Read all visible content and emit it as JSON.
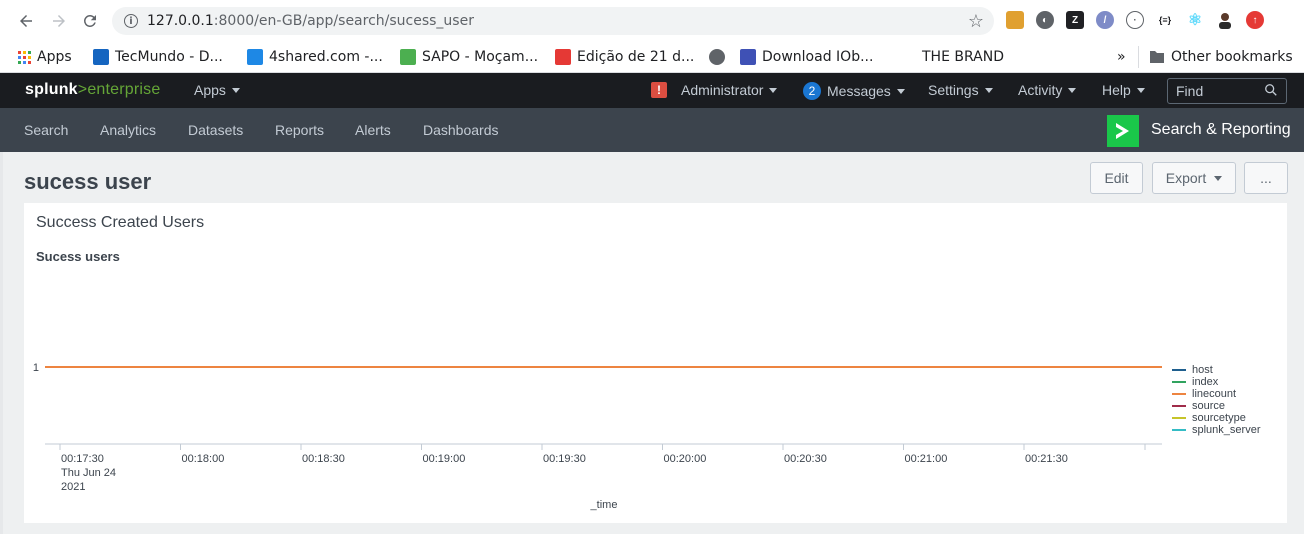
{
  "browser": {
    "url_host": "127.0.0.1",
    "url_path": ":8000/en-GB/app/search/sucess_user",
    "bookmarks": [
      {
        "label": "Apps",
        "color": "#4285f4"
      },
      {
        "label": "TecMundo - D...",
        "color": "#1565c0"
      },
      {
        "label": "4shared.com -...",
        "color": "#1e88e5"
      },
      {
        "label": "SAPO - Moçam...",
        "color": "#4caf50"
      },
      {
        "label": "Edição de 21 d...",
        "color": "#e53935"
      },
      {
        "label": "Download IOb...",
        "color": "#3f51b5"
      },
      {
        "label": "THE BRAND",
        "color": "#ffffff"
      }
    ],
    "more_label": "»",
    "other_bookmarks": "Other bookmarks"
  },
  "splunk": {
    "logo_splunk": "splunk",
    "logo_gt": ">",
    "logo_enterprise": "enterprise",
    "apps_menu": "Apps",
    "alert_glyph": "!",
    "admin_menu": "Administrator",
    "messages_count": "2",
    "messages_menu": "Messages",
    "settings_menu": "Settings",
    "activity_menu": "Activity",
    "help_menu": "Help",
    "find_placeholder": "Find",
    "nav": [
      "Search",
      "Analytics",
      "Datasets",
      "Reports",
      "Alerts",
      "Dashboards"
    ],
    "app_name": "Search & Reporting"
  },
  "page": {
    "title": "sucess user",
    "edit_label": "Edit",
    "export_label": "Export",
    "more_label": "..."
  },
  "panel": {
    "title": "Success Created Users"
  },
  "chart_data": {
    "type": "line",
    "title": "Sucess users",
    "xlabel": "_time",
    "ylabel": "",
    "ytick_labels": [
      "1"
    ],
    "x_tick_labels": [
      "00:17:30",
      "00:18:00",
      "00:18:30",
      "00:19:00",
      "00:19:30",
      "00:20:00",
      "00:20:30",
      "00:21:00",
      "00:21:30"
    ],
    "x_first_tick_sub": [
      "Thu Jun 24",
      "2021"
    ],
    "x": [
      "00:17:20",
      "00:22:00"
    ],
    "series": [
      {
        "name": "host",
        "color": "#1e5e8e",
        "values": [
          1,
          1
        ]
      },
      {
        "name": "index",
        "color": "#31a35f",
        "values": [
          1,
          1
        ]
      },
      {
        "name": "linecount",
        "color": "#ed8440",
        "values": [
          1,
          1
        ]
      },
      {
        "name": "source",
        "color": "#a02c4a",
        "values": [
          1,
          1
        ]
      },
      {
        "name": "sourcetype",
        "color": "#c6c42a",
        "values": [
          1,
          1
        ]
      },
      {
        "name": "splunk_server",
        "color": "#35bcc5",
        "values": [
          1,
          1
        ]
      }
    ],
    "legend_position": "right"
  }
}
